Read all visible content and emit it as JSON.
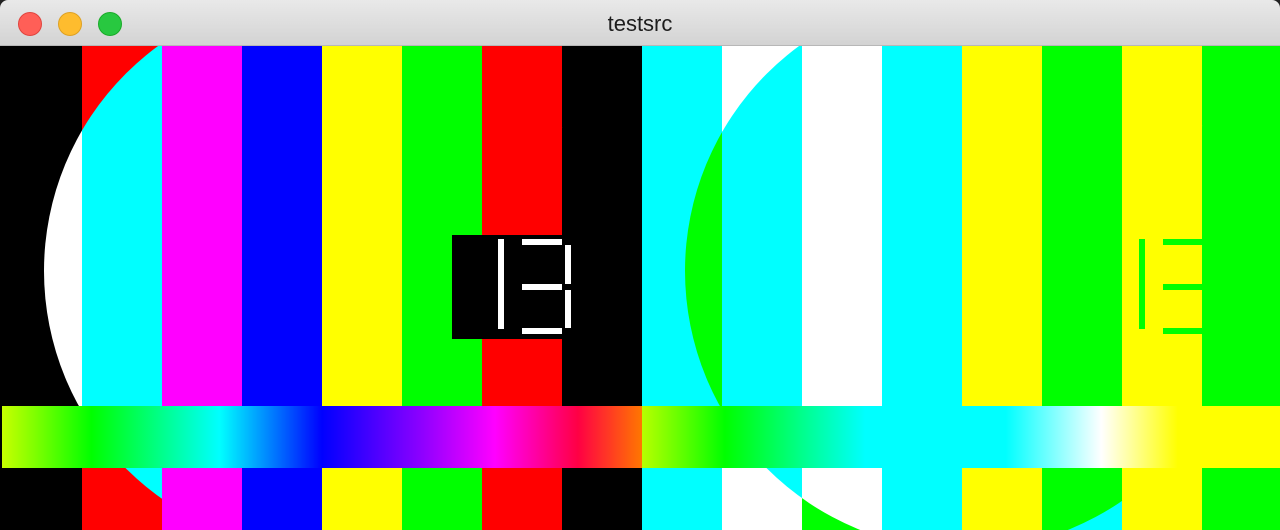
{
  "window": {
    "title": "testsrc",
    "controls": [
      "close-button",
      "minimize-button",
      "maximize-button"
    ]
  },
  "video": {
    "frame_counter": "13",
    "panels": 2
  },
  "colors": {
    "close": "#ff5f57",
    "minimize": "#febc2e",
    "maximize": "#28c840",
    "left_bars": [
      "#000000",
      "#ff0000",
      "#ff00ff",
      "#0000ff",
      "#ffff00",
      "#00ff00",
      "#ff0000",
      "#000000"
    ],
    "left_circle_bars": [
      "#ffffff",
      "#00ffff",
      "#ff00ff",
      "#0000ff",
      "#ffff00",
      "#00ff00",
      "#ff0000",
      "#000000"
    ],
    "right_bars": [
      "#00ffff",
      "#ffffff",
      "#00ff00",
      "#ffff00",
      "#ffffff",
      "#00ffff",
      "#ffff00",
      "#00ff00",
      "#00ffff",
      "#ffffff"
    ],
    "right_circle_bars": [
      "#00ff00",
      "#00ffff",
      "#ffffff",
      "#00ffff",
      "#ffff00",
      "#00ff00",
      "#ffff00",
      "#00ff00"
    ]
  }
}
